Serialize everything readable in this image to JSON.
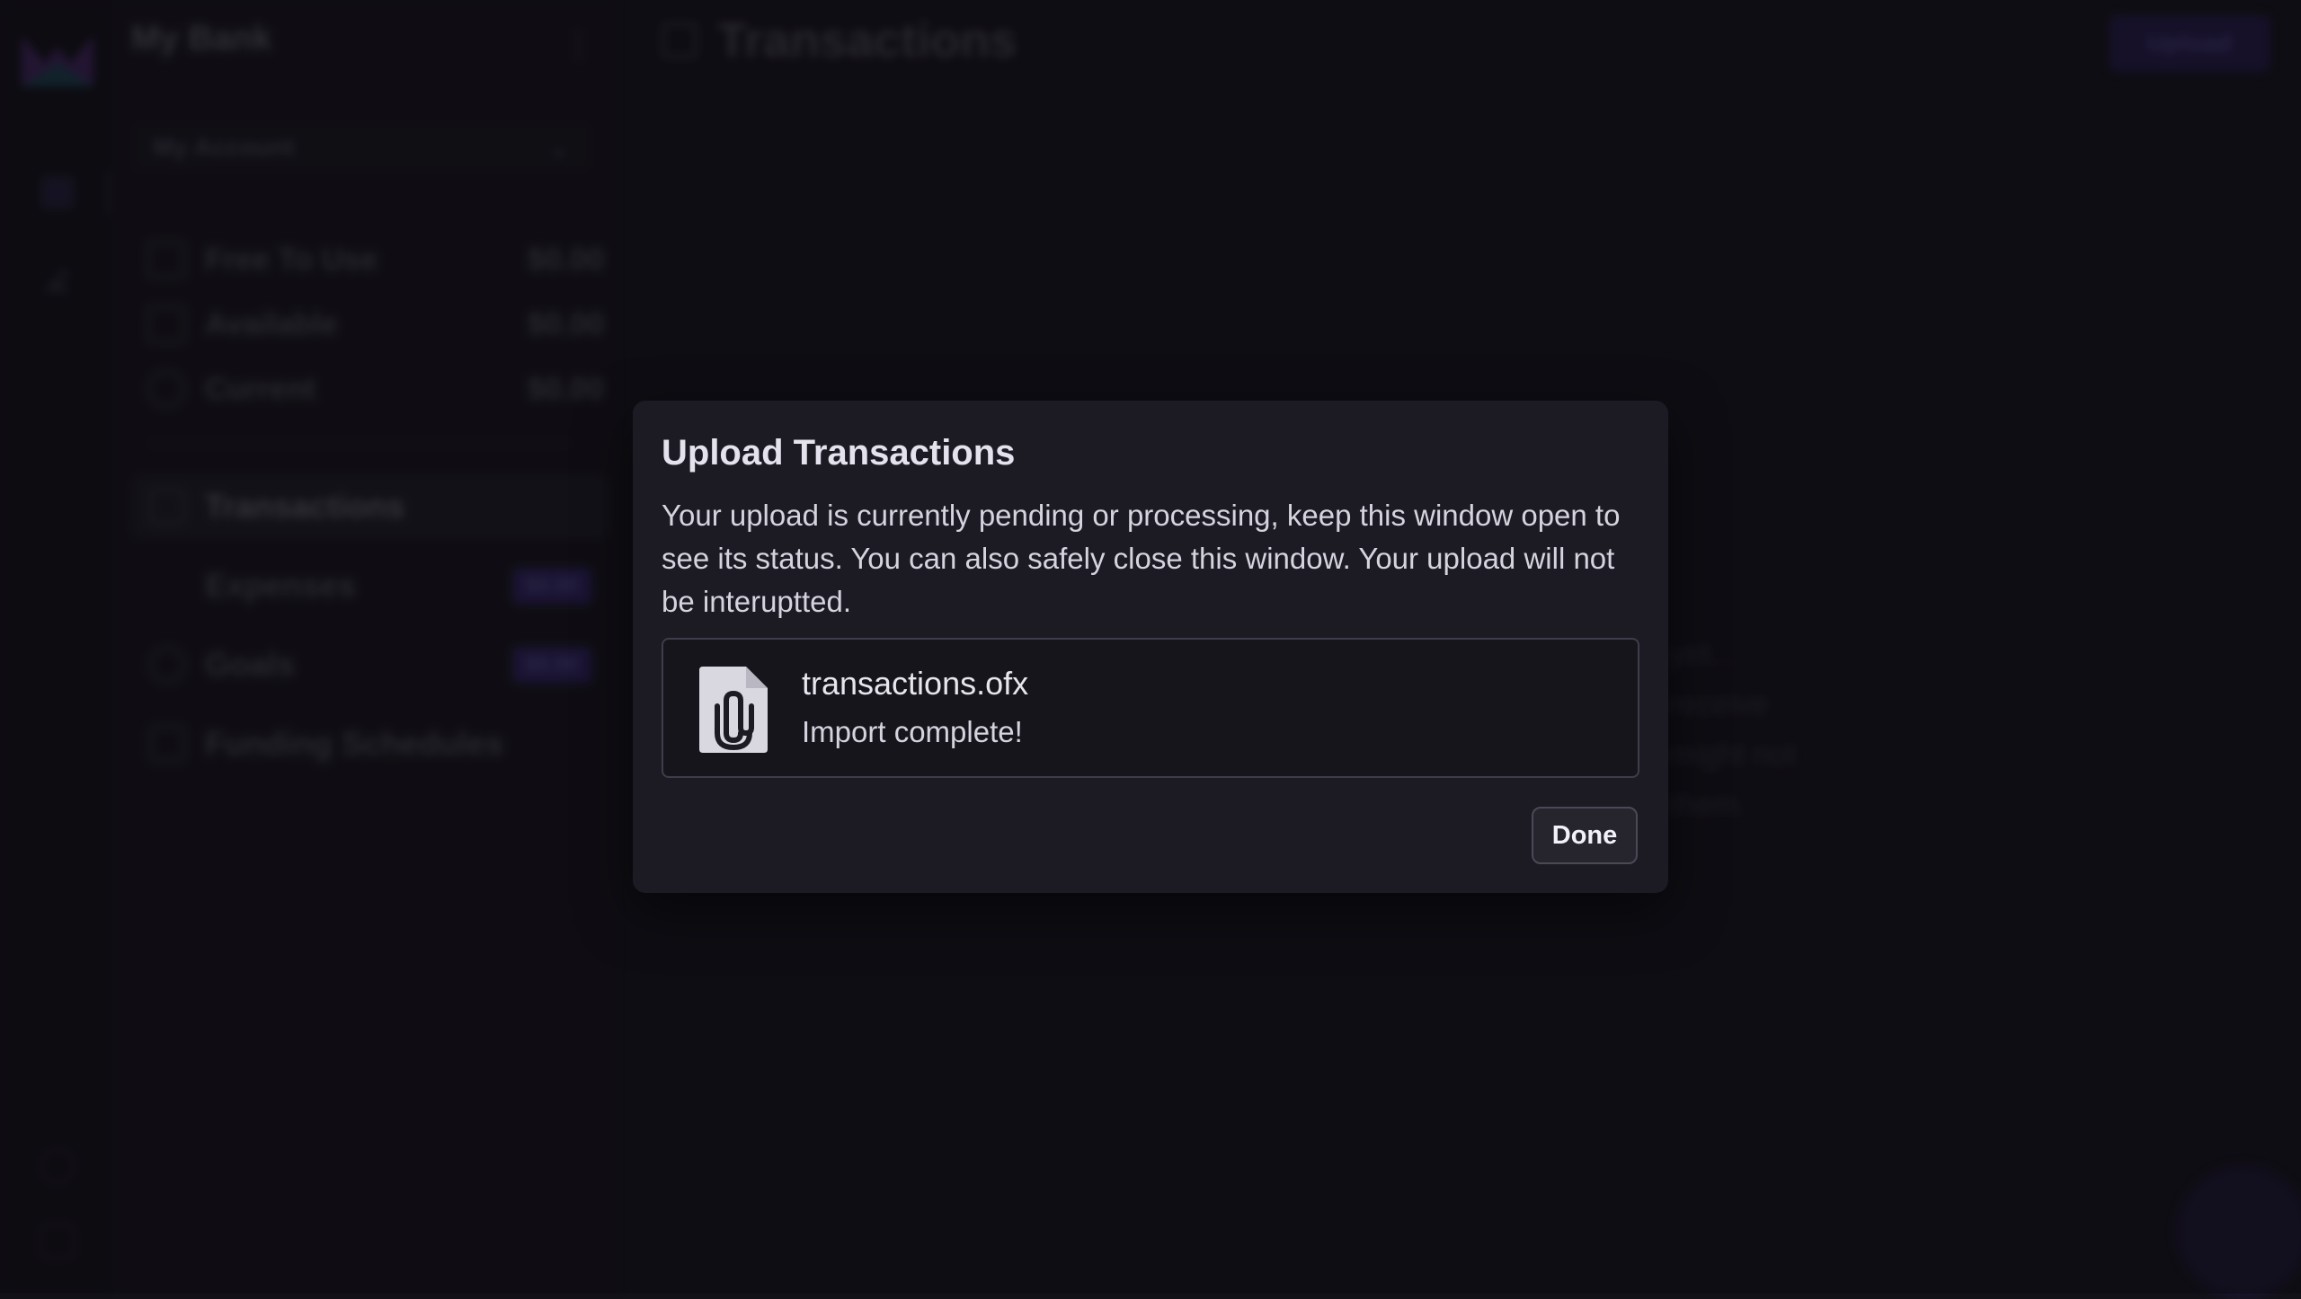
{
  "app": {
    "account_name": "My Bank",
    "account_selector": "My Account",
    "balances": [
      {
        "label": "Free To Use",
        "amount": "$0.00"
      },
      {
        "label": "Available",
        "amount": "$0.00"
      },
      {
        "label": "Current",
        "amount": "$0.00"
      }
    ],
    "nav": [
      {
        "label": "Transactions",
        "badge": ""
      },
      {
        "label": "Expenses",
        "badge": "$0.00"
      },
      {
        "label": "Goals",
        "badge": "$0.00"
      },
      {
        "label": "Funding Schedules",
        "badge": ""
      }
    ],
    "page_title": "Transactions",
    "upload_button": "Upload",
    "empty_state": [
      "... yet...",
      "... receive",
      "... might not",
      "... them."
    ]
  },
  "modal": {
    "title": "Upload Transactions",
    "description": "Your upload is currently pending or processing, keep this window open to see its status. You can also safely close this window. Your upload will not be interuptted.",
    "file": {
      "name": "transactions.ofx",
      "status": "Import complete!",
      "icon": "file-attachment-icon"
    },
    "done_label": "Done"
  },
  "colors": {
    "background": "#121118",
    "modal": "#1c1b24",
    "accent": "#6a58c9"
  }
}
